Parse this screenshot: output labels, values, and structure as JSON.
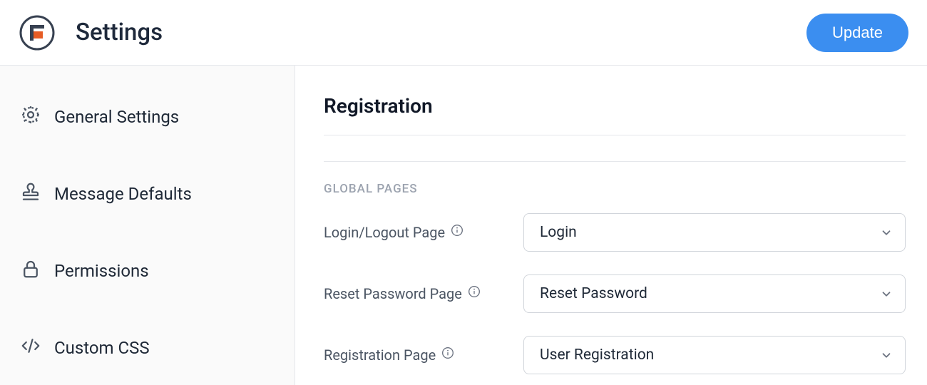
{
  "header": {
    "title": "Settings",
    "update_label": "Update"
  },
  "sidebar": {
    "items": [
      {
        "icon": "gear-icon",
        "label": "General Settings"
      },
      {
        "icon": "stamp-icon",
        "label": "Message Defaults"
      },
      {
        "icon": "lock-icon",
        "label": "Permissions"
      },
      {
        "icon": "code-icon",
        "label": "Custom CSS"
      }
    ]
  },
  "main": {
    "section_title": "Registration",
    "global_pages_label": "GLOBAL PAGES",
    "fields": [
      {
        "label": "Login/Logout Page",
        "selected": "Login"
      },
      {
        "label": "Reset Password Page",
        "selected": "Reset Password"
      },
      {
        "label": "Registration Page",
        "selected": "User Registration"
      }
    ]
  },
  "colors": {
    "accent": "#3b8ef0",
    "logo_accent": "#e65c25",
    "text_primary": "#1f2937",
    "border": "#e5e7eb",
    "muted": "#9ca3af"
  }
}
